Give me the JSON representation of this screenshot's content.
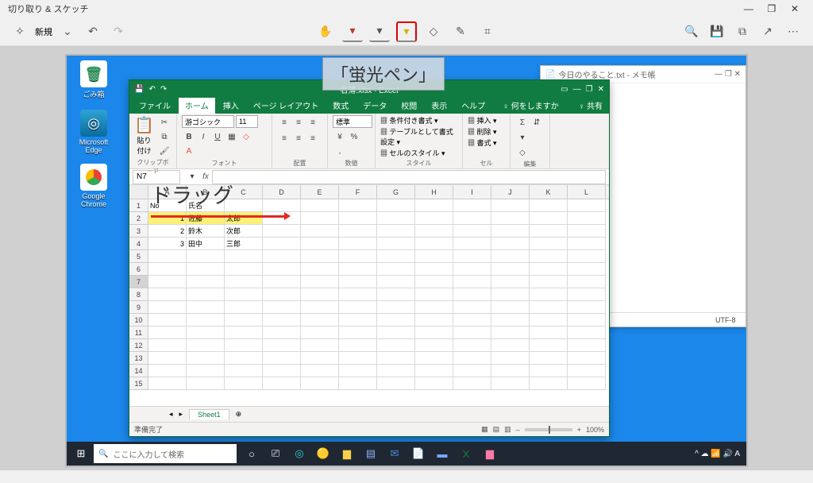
{
  "app": {
    "title": "切り取り & スケッチ",
    "new_label": "新規",
    "tooltip": "「蛍光ペン」",
    "drag_label": "ドラッグ"
  },
  "win_controls": {
    "min": "—",
    "max": "❐",
    "close": "✕"
  },
  "tools": {
    "touch": "✋",
    "pen_red": "▾",
    "pen_black": "▾",
    "highlighter": "▾",
    "eraser": "◇",
    "ruler": "✎",
    "crop": "⌗",
    "zoom": "🔍",
    "save": "💾",
    "copy": "⧉",
    "share": "↗",
    "more": "⋯"
  },
  "desktop": {
    "icons": [
      {
        "name": "ごみ箱",
        "glyph": "🗑",
        "bg": "#ffffff"
      },
      {
        "name": "Microsoft Edge",
        "glyph": "◎",
        "bg": "#0a84d8"
      },
      {
        "name": "Google Chrome",
        "glyph": "◉",
        "bg": "#ffffff"
      }
    ]
  },
  "notepad": {
    "title": "今日のやること.txt - メモ帳",
    "encoding": "UTF-8"
  },
  "excel": {
    "title": "名簿.xlsx - Excel",
    "file_tab": "ファイル",
    "tabs": [
      "ホーム",
      "挿入",
      "ページ レイアウト",
      "数式",
      "データ",
      "校閲",
      "表示",
      "ヘルプ"
    ],
    "tell_me": "♀ 何をしますか",
    "share": "♀ 共有",
    "ribbon": {
      "clipboard": "クリップボード",
      "paste": "貼り付け",
      "font_group": "フォント",
      "font_name": "游ゴシック",
      "font_size": "11",
      "align": "配置",
      "number": "数値",
      "number_format": "標準",
      "styles": "スタイル",
      "cond_fmt": "条件付き書式",
      "table_fmt": "テーブルとして書式設定",
      "cell_style": "セルのスタイル",
      "cells": "セル",
      "insert": "挿入",
      "delete": "削除",
      "format": "書式",
      "editing": "編集"
    },
    "namebox": "N7",
    "columns": [
      "A",
      "B",
      "C",
      "D",
      "E",
      "F",
      "G",
      "H",
      "I",
      "J",
      "K",
      "L"
    ],
    "headers": {
      "A": "No",
      "B": "氏名"
    },
    "data": [
      {
        "no": "1",
        "sei": "佐藤",
        "mei": "太郎"
      },
      {
        "no": "2",
        "sei": "鈴木",
        "mei": "次郎"
      },
      {
        "no": "3",
        "sei": "田中",
        "mei": "三郎"
      }
    ],
    "sheet": "Sheet1",
    "status": "準備完了",
    "zoom": "100%"
  },
  "taskbar": {
    "search_placeholder": "ここに入力して検索",
    "tray_icons": "^ ☁ 📶 🔊 A"
  }
}
